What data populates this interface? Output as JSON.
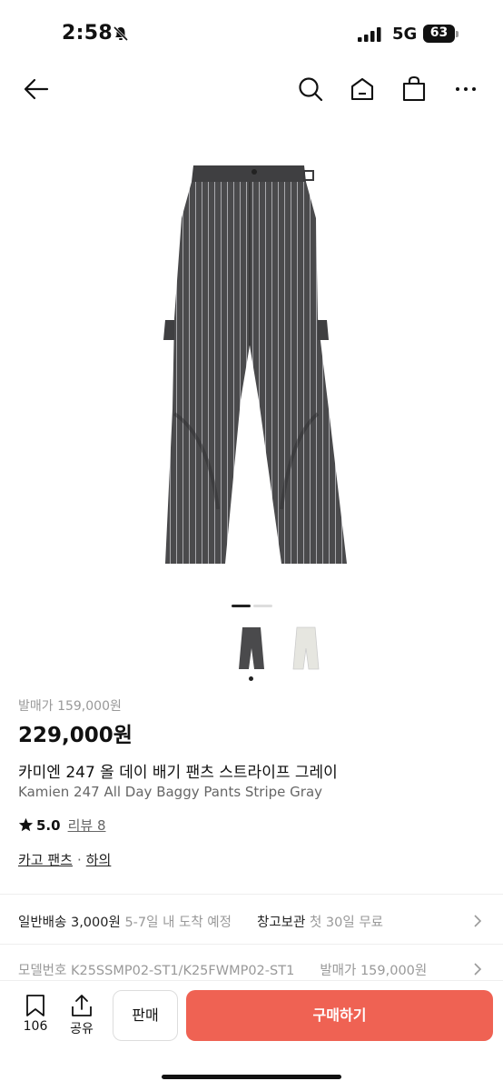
{
  "status_bar": {
    "time": "2:58",
    "network": "5G",
    "battery": "63"
  },
  "nav": {
    "icons": [
      "back-arrow-icon",
      "search-icon",
      "home-icon",
      "shopping-bag-icon",
      "more-icon"
    ]
  },
  "product": {
    "original_price": "발매가 159,000원",
    "price": "229,000원",
    "title_ko": "카미엔 247 올 데이 배기 팬츠 스트라이프 그레이",
    "title_en": "Kamien 247 All Day Baggy Pants Stripe Gray",
    "rating": "5.0",
    "reviews": "리뷰 8",
    "category_1": "카고 팬츠",
    "category_sep": "·",
    "category_2": "하의"
  },
  "shipping": {
    "label": "일반배송 3,000원",
    "eta": "5-7일 내 도착 예정",
    "storage": "창고보관",
    "storage_note": "첫 30일 무료"
  },
  "model": {
    "label": "모델번호 K25SSMP02-ST1/K25FWMP02-ST1",
    "release": "발매가 159,000원"
  },
  "bottom_bar": {
    "bookmark_count": "106",
    "share_label": "공유",
    "sell_label": "판매",
    "buy_label": "구매하기"
  },
  "colors": {
    "accent": "#ef6253",
    "pants": "#4a4a4c"
  }
}
